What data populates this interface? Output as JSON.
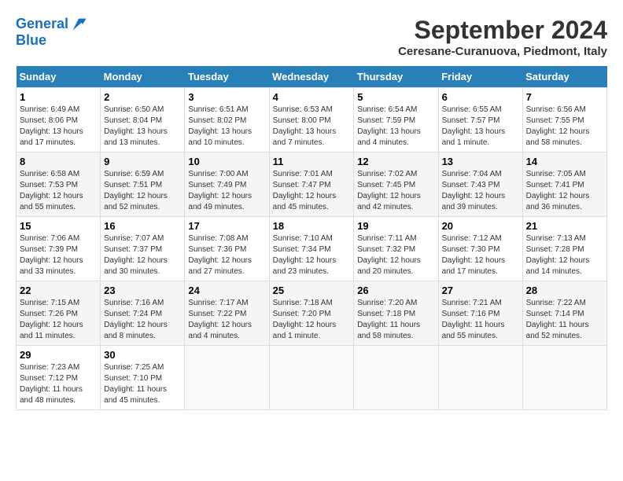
{
  "header": {
    "logo_line1": "General",
    "logo_line2": "Blue",
    "month": "September 2024",
    "location": "Ceresane-Curanuova, Piedmont, Italy"
  },
  "weekdays": [
    "Sunday",
    "Monday",
    "Tuesday",
    "Wednesday",
    "Thursday",
    "Friday",
    "Saturday"
  ],
  "weeks": [
    [
      {
        "day": "1",
        "info": "Sunrise: 6:49 AM\nSunset: 8:06 PM\nDaylight: 13 hours\nand 17 minutes."
      },
      {
        "day": "2",
        "info": "Sunrise: 6:50 AM\nSunset: 8:04 PM\nDaylight: 13 hours\nand 13 minutes."
      },
      {
        "day": "3",
        "info": "Sunrise: 6:51 AM\nSunset: 8:02 PM\nDaylight: 13 hours\nand 10 minutes."
      },
      {
        "day": "4",
        "info": "Sunrise: 6:53 AM\nSunset: 8:00 PM\nDaylight: 13 hours\nand 7 minutes."
      },
      {
        "day": "5",
        "info": "Sunrise: 6:54 AM\nSunset: 7:59 PM\nDaylight: 13 hours\nand 4 minutes."
      },
      {
        "day": "6",
        "info": "Sunrise: 6:55 AM\nSunset: 7:57 PM\nDaylight: 13 hours\nand 1 minute."
      },
      {
        "day": "7",
        "info": "Sunrise: 6:56 AM\nSunset: 7:55 PM\nDaylight: 12 hours\nand 58 minutes."
      }
    ],
    [
      {
        "day": "8",
        "info": "Sunrise: 6:58 AM\nSunset: 7:53 PM\nDaylight: 12 hours\nand 55 minutes."
      },
      {
        "day": "9",
        "info": "Sunrise: 6:59 AM\nSunset: 7:51 PM\nDaylight: 12 hours\nand 52 minutes."
      },
      {
        "day": "10",
        "info": "Sunrise: 7:00 AM\nSunset: 7:49 PM\nDaylight: 12 hours\nand 49 minutes."
      },
      {
        "day": "11",
        "info": "Sunrise: 7:01 AM\nSunset: 7:47 PM\nDaylight: 12 hours\nand 45 minutes."
      },
      {
        "day": "12",
        "info": "Sunrise: 7:02 AM\nSunset: 7:45 PM\nDaylight: 12 hours\nand 42 minutes."
      },
      {
        "day": "13",
        "info": "Sunrise: 7:04 AM\nSunset: 7:43 PM\nDaylight: 12 hours\nand 39 minutes."
      },
      {
        "day": "14",
        "info": "Sunrise: 7:05 AM\nSunset: 7:41 PM\nDaylight: 12 hours\nand 36 minutes."
      }
    ],
    [
      {
        "day": "15",
        "info": "Sunrise: 7:06 AM\nSunset: 7:39 PM\nDaylight: 12 hours\nand 33 minutes."
      },
      {
        "day": "16",
        "info": "Sunrise: 7:07 AM\nSunset: 7:37 PM\nDaylight: 12 hours\nand 30 minutes."
      },
      {
        "day": "17",
        "info": "Sunrise: 7:08 AM\nSunset: 7:36 PM\nDaylight: 12 hours\nand 27 minutes."
      },
      {
        "day": "18",
        "info": "Sunrise: 7:10 AM\nSunset: 7:34 PM\nDaylight: 12 hours\nand 23 minutes."
      },
      {
        "day": "19",
        "info": "Sunrise: 7:11 AM\nSunset: 7:32 PM\nDaylight: 12 hours\nand 20 minutes."
      },
      {
        "day": "20",
        "info": "Sunrise: 7:12 AM\nSunset: 7:30 PM\nDaylight: 12 hours\nand 17 minutes."
      },
      {
        "day": "21",
        "info": "Sunrise: 7:13 AM\nSunset: 7:28 PM\nDaylight: 12 hours\nand 14 minutes."
      }
    ],
    [
      {
        "day": "22",
        "info": "Sunrise: 7:15 AM\nSunset: 7:26 PM\nDaylight: 12 hours\nand 11 minutes."
      },
      {
        "day": "23",
        "info": "Sunrise: 7:16 AM\nSunset: 7:24 PM\nDaylight: 12 hours\nand 8 minutes."
      },
      {
        "day": "24",
        "info": "Sunrise: 7:17 AM\nSunset: 7:22 PM\nDaylight: 12 hours\nand 4 minutes."
      },
      {
        "day": "25",
        "info": "Sunrise: 7:18 AM\nSunset: 7:20 PM\nDaylight: 12 hours\nand 1 minute."
      },
      {
        "day": "26",
        "info": "Sunrise: 7:20 AM\nSunset: 7:18 PM\nDaylight: 11 hours\nand 58 minutes."
      },
      {
        "day": "27",
        "info": "Sunrise: 7:21 AM\nSunset: 7:16 PM\nDaylight: 11 hours\nand 55 minutes."
      },
      {
        "day": "28",
        "info": "Sunrise: 7:22 AM\nSunset: 7:14 PM\nDaylight: 11 hours\nand 52 minutes."
      }
    ],
    [
      {
        "day": "29",
        "info": "Sunrise: 7:23 AM\nSunset: 7:12 PM\nDaylight: 11 hours\nand 48 minutes."
      },
      {
        "day": "30",
        "info": "Sunrise: 7:25 AM\nSunset: 7:10 PM\nDaylight: 11 hours\nand 45 minutes."
      },
      {
        "day": "",
        "info": ""
      },
      {
        "day": "",
        "info": ""
      },
      {
        "day": "",
        "info": ""
      },
      {
        "day": "",
        "info": ""
      },
      {
        "day": "",
        "info": ""
      }
    ]
  ]
}
